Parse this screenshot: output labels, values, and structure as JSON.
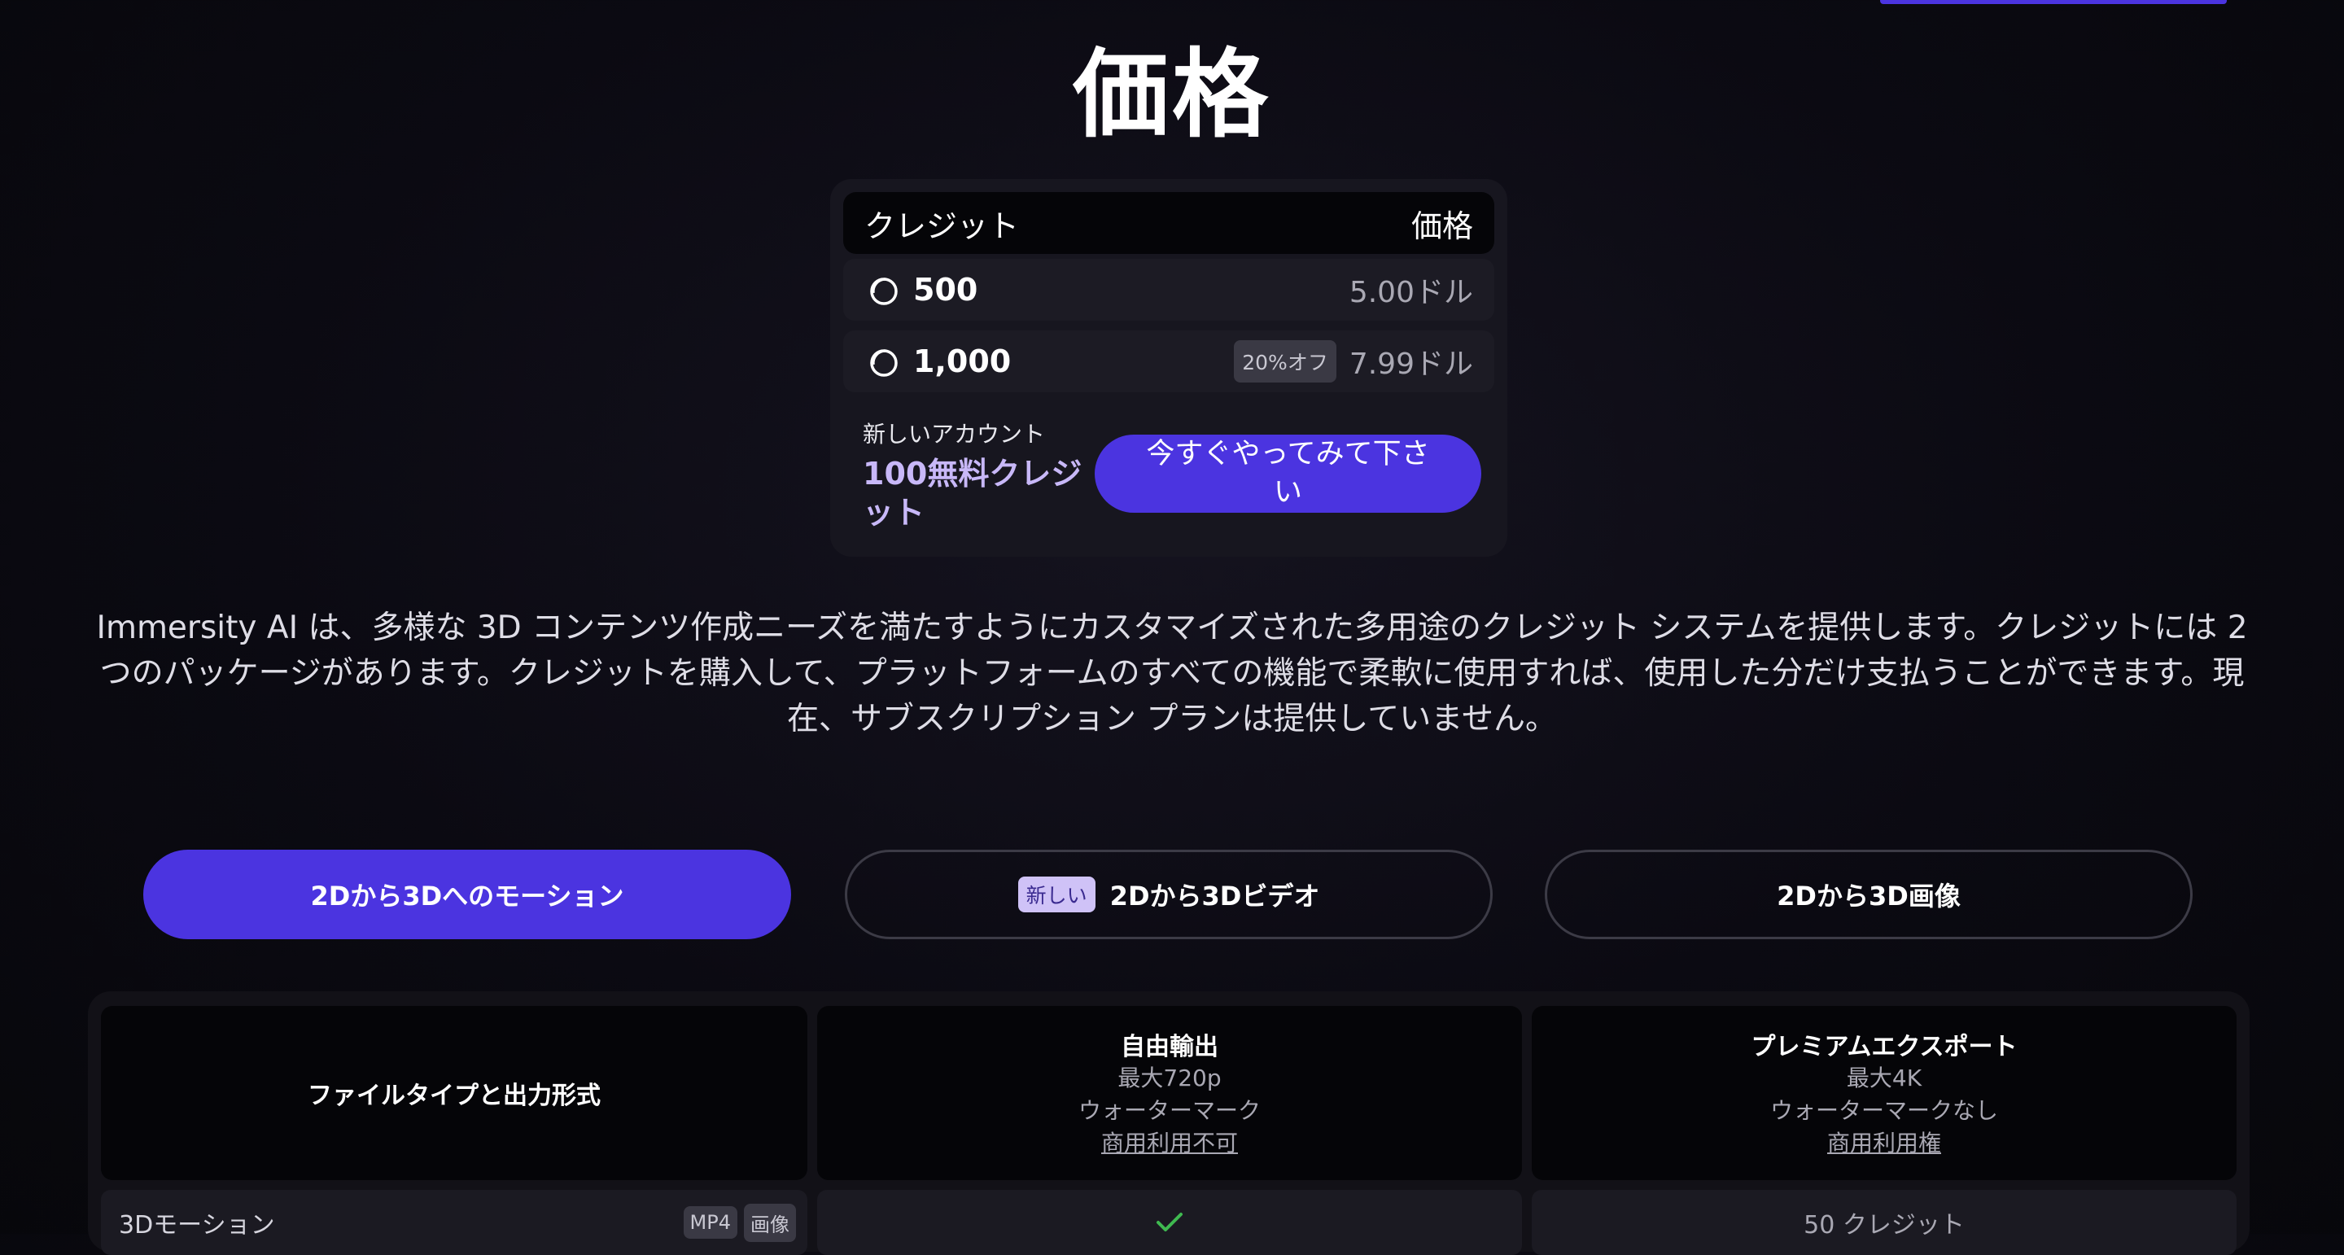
{
  "title": "価格",
  "price_table": {
    "header_credit": "クレジット",
    "header_price": "価格",
    "rows": [
      {
        "credits": "500",
        "discount": "",
        "price": "5.00ドル"
      },
      {
        "credits": "1,000",
        "discount": "20%オフ",
        "price": "7.99ドル"
      }
    ],
    "promo_label": "新しいアカウント",
    "promo_credit": "100無料クレジット",
    "cta": "今すぐやってみて下さい",
    "coin_icon": "coin-icon"
  },
  "description": "Immersity AI は、多様な 3D コンテンツ作成ニーズを満たすようにカスタマイズされた多用途のクレジット システムを提供します。クレジットには 2 つのパッケージがあります。クレジットを購入して、プラットフォームのすべての機能で柔軟に使用すれば、使用した分だけ支払うことができます。現在、サブスクリプション プランは提供していません。",
  "tabs": [
    {
      "label": "2Dから3Dへのモーション",
      "active": true
    },
    {
      "label": "2Dから3Dビデオ",
      "badge": "新しい"
    },
    {
      "label": "2Dから3D画像"
    }
  ],
  "comparison": {
    "col1_title": "ファイルタイプと出力形式",
    "col2": {
      "title": "自由輸出",
      "line1": "最大720p",
      "line2": "ウォーターマーク",
      "link": "商用利用不可"
    },
    "col3": {
      "title": "プレミアムエクスポート",
      "line1": "最大4K",
      "line2": "ウォーターマークなし",
      "link": "商用利用権"
    },
    "rows": [
      {
        "label": "3Dモーション",
        "formats": [
          "MP4",
          "画像"
        ],
        "free_icon": "check-icon",
        "premium": "50 クレジット"
      }
    ]
  },
  "colors": {
    "accent": "#4b34e0",
    "promo": "#c8b8f8",
    "check": "#3fb950"
  }
}
